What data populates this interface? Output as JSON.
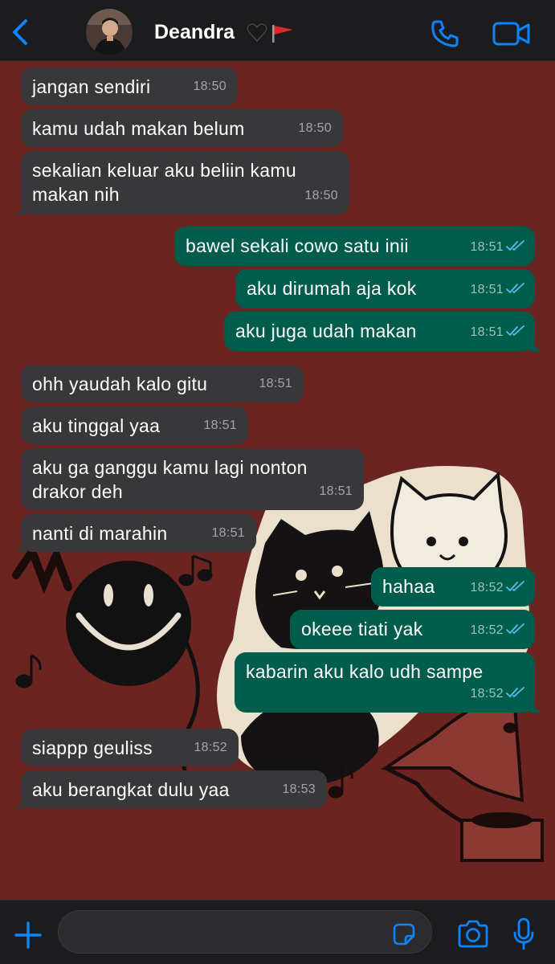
{
  "header": {
    "contact_name": "Deandra",
    "name_icons": [
      "black-heart-icon",
      "red-flag-icon"
    ],
    "back_icon": "chevron-left-icon",
    "call_icon": "phone-icon",
    "video_icon": "video-camera-icon"
  },
  "colors": {
    "accent": "#0a84ff",
    "incoming_bubble": "#38383a",
    "outgoing_bubble": "#005c4b",
    "read_ticks": "#53bdeb",
    "wallpaper": "#6b2420",
    "bar": "#1c1c1e"
  },
  "messages": [
    {
      "direction": "in",
      "text": "jangan sendiri",
      "time": "18:50"
    },
    {
      "direction": "in",
      "text": "kamu udah makan belum",
      "time": "18:50"
    },
    {
      "direction": "in",
      "text": "sekalian keluar aku beliin kamu makan nih",
      "time": "18:50"
    },
    {
      "direction": "out",
      "text": "bawel sekali cowo satu inii",
      "time": "18:51",
      "status": "read"
    },
    {
      "direction": "out",
      "text": "aku dirumah aja kok",
      "time": "18:51",
      "status": "read"
    },
    {
      "direction": "out",
      "text": "aku juga udah makan",
      "time": "18:51",
      "status": "read"
    },
    {
      "direction": "in",
      "text": "ohh yaudah kalo gitu",
      "time": "18:51"
    },
    {
      "direction": "in",
      "text": "aku tinggal yaa",
      "time": "18:51"
    },
    {
      "direction": "in",
      "text": "aku ga ganggu kamu lagi nonton drakor deh",
      "time": "18:51"
    },
    {
      "direction": "in",
      "text": "nanti di marahin",
      "time": "18:51"
    },
    {
      "direction": "out",
      "text": "hahaa",
      "time": "18:52",
      "status": "read"
    },
    {
      "direction": "out",
      "text": "okeee tiati yak",
      "time": "18:52",
      "status": "read"
    },
    {
      "direction": "out",
      "text": "kabarin aku kalo udh sampe",
      "time": "18:52",
      "status": "read"
    },
    {
      "direction": "in",
      "text": "siappp geuliss",
      "time": "18:52"
    },
    {
      "direction": "in",
      "text": "aku berangkat dulu yaa",
      "time": "18:53"
    }
  ],
  "input_bar": {
    "message_value": "",
    "plus_icon": "plus-icon",
    "sticker_icon": "sticker-icon",
    "camera_icon": "camera-icon",
    "mic_icon": "microphone-icon"
  }
}
